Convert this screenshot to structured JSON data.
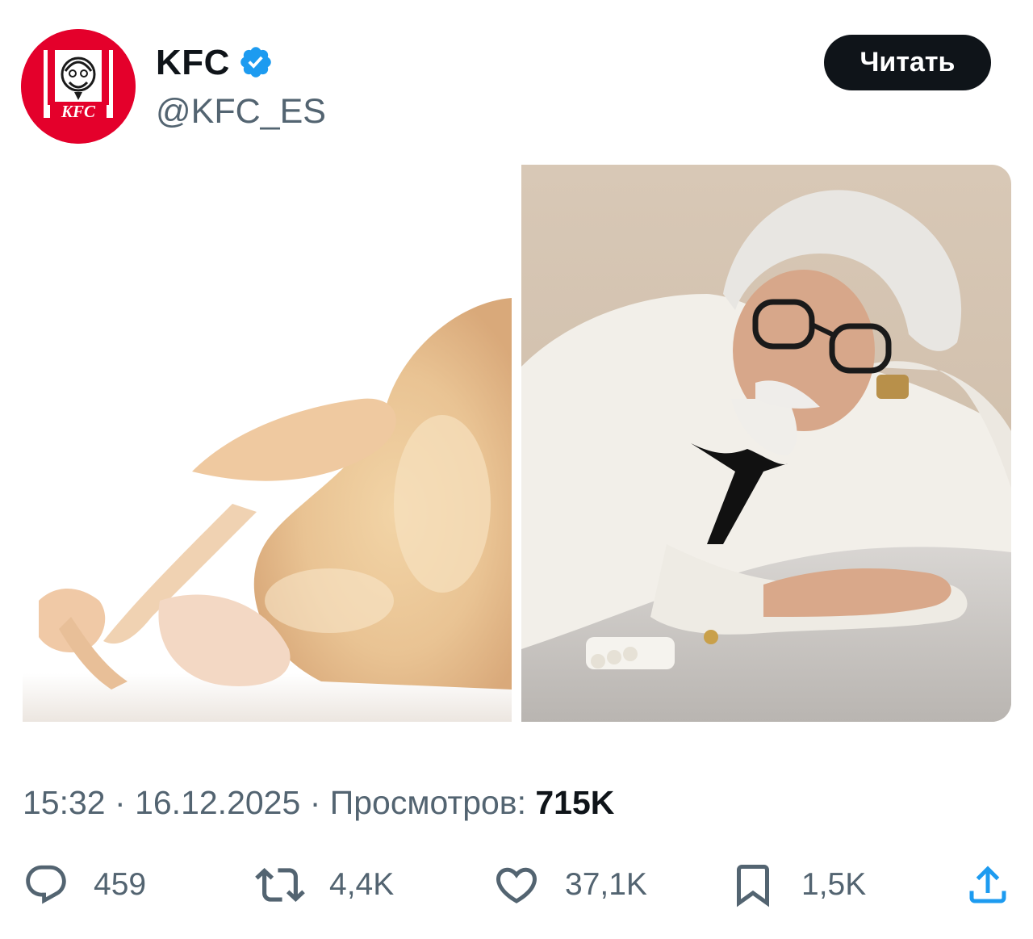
{
  "author": {
    "name": "KFC",
    "handle": "@KFC_ES",
    "verified": true,
    "avatar_logo_text": "KFC",
    "brand_color": "#e4002b"
  },
  "follow_button": {
    "label": "Читать"
  },
  "media": [
    {
      "name": "raw-chicken-photo"
    },
    {
      "name": "colonel-sanders-photo"
    }
  ],
  "meta": {
    "time": "15:32",
    "separator": "·",
    "date": "16.12.2025",
    "views_label": "Просмотров:",
    "views_value": "715K"
  },
  "actions": {
    "reply": {
      "icon": "reply-icon",
      "count": "459"
    },
    "repost": {
      "icon": "repost-icon",
      "count": "4,4K"
    },
    "like": {
      "icon": "heart-icon",
      "count": "37,1K"
    },
    "bookmark": {
      "icon": "bookmark-icon",
      "count": "1,5K"
    },
    "share": {
      "icon": "share-icon"
    }
  },
  "colors": {
    "text_primary": "#0f1419",
    "text_secondary": "#536471",
    "verified_blue": "#1d9bf0"
  }
}
